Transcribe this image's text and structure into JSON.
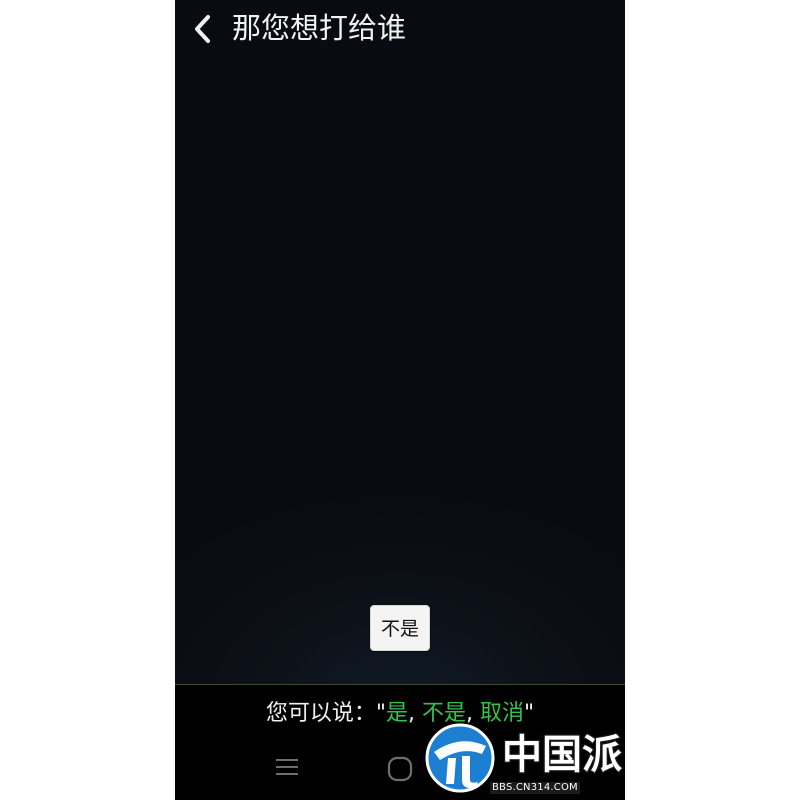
{
  "header": {
    "back_icon": "chevron-left-icon",
    "title": "那您想打给谁"
  },
  "answer_button": {
    "label": "不是"
  },
  "hint": {
    "prefix": "您可以说：\"",
    "option_1": "是",
    "sep_1": ", ",
    "option_2": "不是",
    "sep_2": ", ",
    "option_3": "取消",
    "suffix": "\""
  },
  "nav": {
    "menu_icon": "menu-icon",
    "home_icon": "home-icon"
  },
  "watermark": {
    "logo_text": "中国派",
    "url": "BBS.CN314.COM"
  },
  "colors": {
    "background": "#0a0a12",
    "option_green": "#35c24a",
    "title_text": "#f2f2f2"
  }
}
